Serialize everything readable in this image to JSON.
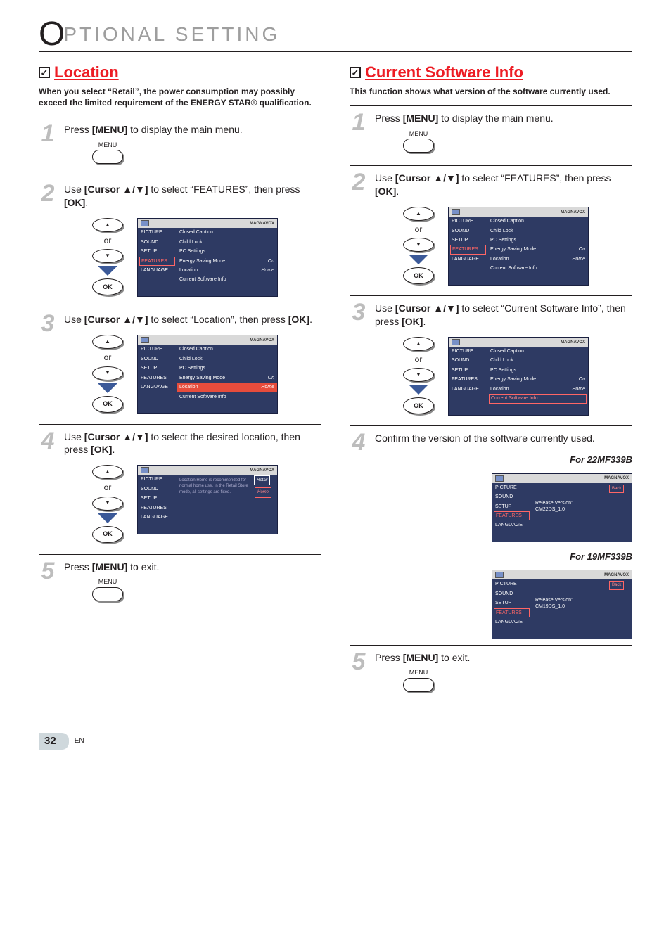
{
  "page": {
    "title_rest": "PTIONAL  SETTING",
    "number": "32",
    "lang": "EN"
  },
  "ui": {
    "menu_label": "MENU",
    "or": "or",
    "ok": "OK",
    "check": "✓",
    "arrow_up": "▲",
    "arrow_down": "▼",
    "brand": "MAGNAVOX"
  },
  "left": {
    "title": "Location",
    "subtitle": "When you select “Retail”, the power consumption may possibly exceed the limited requirement of the ENERGY STAR® qualification.",
    "steps": {
      "s1": {
        "num": "1",
        "pre": "Press ",
        "bold": "[MENU]",
        "post": " to display the main menu."
      },
      "s2": {
        "num": "2",
        "pre": "Use ",
        "bold": "[Cursor ▲/▼]",
        "mid": " to select “FEATURES”, then press ",
        "bold2": "[OK]",
        "end": "."
      },
      "s3": {
        "num": "3",
        "pre": "Use ",
        "bold": "[Cursor ▲/▼]",
        "mid": " to select “Location”, then press ",
        "bold2": "[OK]",
        "end": "."
      },
      "s4": {
        "num": "4",
        "pre": "Use ",
        "bold": "[Cursor ▲/▼]",
        "mid": " to select the desired location, then press ",
        "bold2": "[OK]",
        "end": "."
      },
      "s5": {
        "num": "5",
        "pre": "Press ",
        "bold": "[MENU]",
        "post": " to exit."
      }
    },
    "osd1": {
      "left": [
        "PICTURE",
        "SOUND",
        "SETUP",
        "FEATURES",
        "LANGUAGE"
      ],
      "hl_index": 3,
      "mid": [
        {
          "l": "Closed Caption",
          "r": ""
        },
        {
          "l": "Child Lock",
          "r": ""
        },
        {
          "l": "PC Settings",
          "r": ""
        },
        {
          "l": "Energy Saving Mode",
          "r": "On"
        },
        {
          "l": "Location",
          "r": "Home"
        },
        {
          "l": "Current Software Info",
          "r": ""
        }
      ]
    },
    "osd2": {
      "left": [
        "PICTURE",
        "SOUND",
        "SETUP",
        "FEATURES",
        "LANGUAGE"
      ],
      "mid": [
        {
          "l": "Closed Caption",
          "r": ""
        },
        {
          "l": "Child Lock",
          "r": ""
        },
        {
          "l": "PC Settings",
          "r": ""
        },
        {
          "l": "Energy Saving Mode",
          "r": "On"
        },
        {
          "l": "Location",
          "r": "Home",
          "sel": true
        },
        {
          "l": "Current Software Info",
          "r": ""
        }
      ]
    },
    "osd3": {
      "left": [
        "PICTURE",
        "SOUND",
        "SETUP",
        "FEATURES",
        "LANGUAGE"
      ],
      "desc": "Location Home is recommended for normal home use. In the Retail Store mode, all settings are fixed.",
      "opts": [
        "Retail",
        "Home"
      ],
      "sel_index": 1
    }
  },
  "right": {
    "title": "Current Software Info",
    "subtitle": "This function shows what version of the software currently used.",
    "steps": {
      "s1": {
        "num": "1",
        "pre": "Press ",
        "bold": "[MENU]",
        "post": " to display the main menu."
      },
      "s2": {
        "num": "2",
        "pre": "Use ",
        "bold": "[Cursor ▲/▼]",
        "mid": " to select “FEATURES”, then press ",
        "bold2": "[OK]",
        "end": "."
      },
      "s3": {
        "num": "3",
        "pre": "Use ",
        "bold": "[Cursor ▲/▼]",
        "mid": " to select “Current Software Info”, then press ",
        "bold2": "[OK]",
        "end": "."
      },
      "s4": {
        "num": "4",
        "text": "Confirm the version of the software currently used."
      },
      "s5": {
        "num": "5",
        "pre": "Press ",
        "bold": "[MENU]",
        "post": " to exit."
      }
    },
    "osd1": {
      "left": [
        "PICTURE",
        "SOUND",
        "SETUP",
        "FEATURES",
        "LANGUAGE"
      ],
      "hl_index": 3,
      "mid": [
        {
          "l": "Closed Caption",
          "r": ""
        },
        {
          "l": "Child Lock",
          "r": ""
        },
        {
          "l": "PC Settings",
          "r": ""
        },
        {
          "l": "Energy Saving Mode",
          "r": "On"
        },
        {
          "l": "Location",
          "r": "Home"
        },
        {
          "l": "Current Software Info",
          "r": ""
        }
      ]
    },
    "osd2": {
      "left": [
        "PICTURE",
        "SOUND",
        "SETUP",
        "FEATURES",
        "LANGUAGE"
      ],
      "mid": [
        {
          "l": "Closed Caption",
          "r": ""
        },
        {
          "l": "Child Lock",
          "r": ""
        },
        {
          "l": "PC Settings",
          "r": ""
        },
        {
          "l": "Energy Saving Mode",
          "r": "On"
        },
        {
          "l": "Location",
          "r": "Home"
        },
        {
          "l": "Current Software Info",
          "r": "",
          "selb": true
        }
      ]
    },
    "model_a": "For 22MF339B",
    "model_b": "For 19MF339B",
    "ver_a": {
      "left": [
        "PICTURE",
        "SOUND",
        "SETUP",
        "FEATURES",
        "LANGUAGE"
      ],
      "hl_index": 3,
      "line1": "Release Version:",
      "line2": "CM22DS_1.0",
      "back": "Back"
    },
    "ver_b": {
      "left": [
        "PICTURE",
        "SOUND",
        "SETUP",
        "FEATURES",
        "LANGUAGE"
      ],
      "hl_index": 3,
      "line1": "Release Version:",
      "line2": "CM19DS_1.0",
      "back": "Back"
    }
  }
}
